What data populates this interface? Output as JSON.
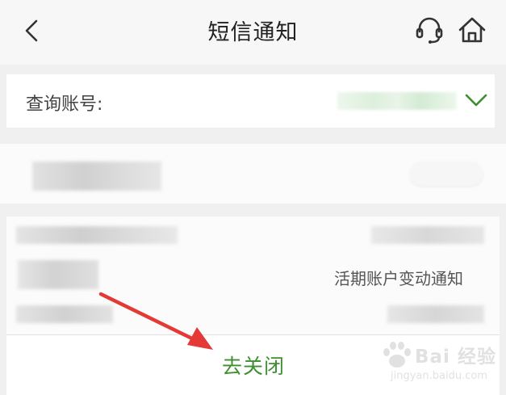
{
  "header": {
    "title": "短信通知",
    "back_icon": "back-arrow-icon",
    "service_icon": "headset-icon",
    "home_icon": "home-icon"
  },
  "account": {
    "label": "查询账号:",
    "dropdown_icon": "chevron-down-icon",
    "accent_color": "#3d8f2f"
  },
  "notification": {
    "type_label": "活期账户变动通知"
  },
  "action": {
    "close_label": "去关闭"
  },
  "annotation": {
    "arrow_color": "#e53935"
  },
  "watermark": {
    "brand": "Bai 经验",
    "url": "jingyan.baidu.com"
  }
}
